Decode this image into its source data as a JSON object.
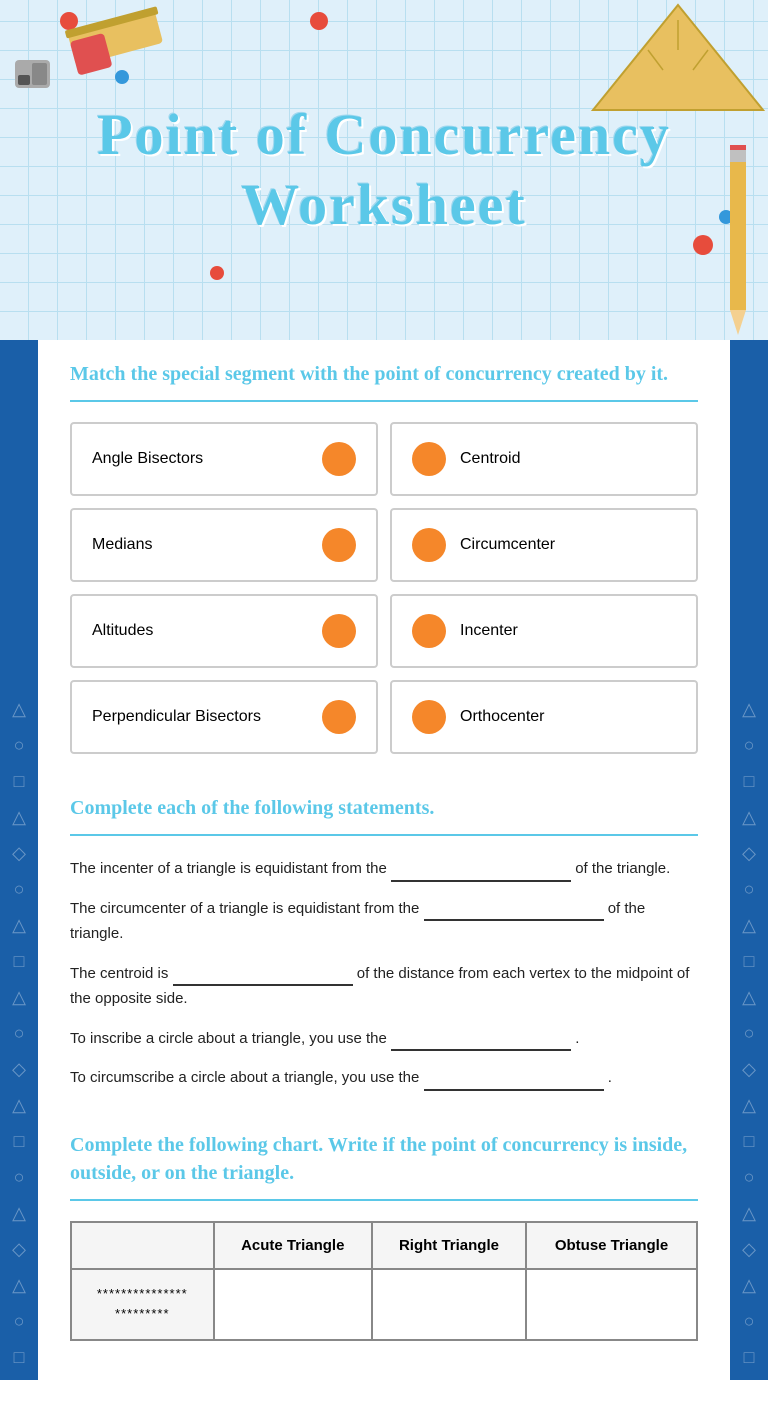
{
  "header": {
    "title_line1": "Point of Concurrency",
    "title_line2": "Worksheet"
  },
  "matching_section": {
    "instruction": "Match the special segment with the point of concurrency created by it.",
    "left_items": [
      {
        "label": "Angle Bisectors"
      },
      {
        "label": "Medians"
      },
      {
        "label": "Altitudes"
      },
      {
        "label": "Perpendicular Bisectors"
      }
    ],
    "right_items": [
      {
        "label": "Centroid"
      },
      {
        "label": "Circumcenter"
      },
      {
        "label": "Incenter"
      },
      {
        "label": "Orthocenter"
      }
    ]
  },
  "statements_section": {
    "header": "Complete each of the following statements.",
    "statements": [
      {
        "before": "The incenter of a triangle is equidistant from the",
        "after": "of the triangle."
      },
      {
        "before": "The circumcenter of a triangle is equidistant from the",
        "after": "of the triangle."
      },
      {
        "before": "The centroid is",
        "after": "of the distance from each vertex to the midpoint of the opposite side."
      },
      {
        "before": "To inscribe a circle about a triangle, you use the",
        "after": "."
      },
      {
        "before": "To circumscribe a circle about a triangle, you use the",
        "after": "."
      }
    ]
  },
  "chart_section": {
    "header": "Complete the following chart.  Write if the point of concurrency is inside, outside, or on the triangle.",
    "columns": [
      "",
      "Acute Triangle",
      "Right Triangle",
      "Obtuse Triangle"
    ],
    "asterisk_text": "***************\n*********"
  }
}
